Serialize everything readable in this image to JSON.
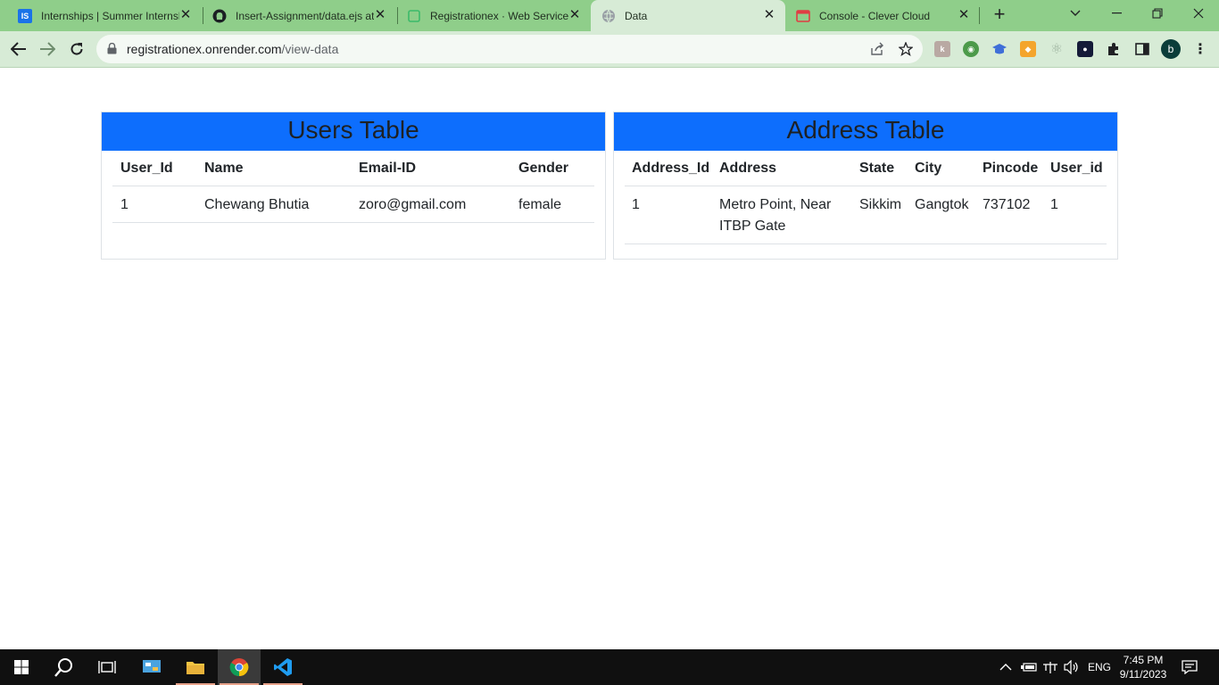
{
  "browser": {
    "tabs": [
      {
        "title": "Internships | Summer Internships",
        "favicon": "internshala-icon",
        "favicon_text": "IS",
        "favicon_color": "#1a73e8"
      },
      {
        "title": "Insert-Assignment/data.ejs at main",
        "favicon": "github-icon"
      },
      {
        "title": "Registrationex · Web Service",
        "favicon": "render-icon"
      },
      {
        "title": "Data",
        "favicon": "globe-icon",
        "active": true
      },
      {
        "title": "Console - Clever Cloud",
        "favicon": "clever-cloud-icon",
        "favicon_color": "#e03c43"
      }
    ],
    "address": {
      "host": "registrationex.onrender.com",
      "path": "/view-data"
    },
    "profile_initial": "b",
    "colors": {
      "tabstrip": "#8fce8a",
      "toolbar": "#d7ebd6"
    }
  },
  "users_table": {
    "title": "Users Table",
    "columns": [
      "User_Id",
      "Name",
      "Email-ID",
      "Gender"
    ],
    "rows": [
      [
        "1",
        "Chewang Bhutia",
        "zoro@gmail.com",
        "female"
      ]
    ]
  },
  "address_table": {
    "title": "Address Table",
    "columns": [
      "Address_Id",
      "Address",
      "State",
      "City",
      "Pincode",
      "User_id"
    ],
    "rows": [
      [
        "1",
        "Metro Point, Near",
        "ITBP Gate",
        "Sikkim",
        "Gangtok",
        "737102",
        "1"
      ]
    ]
  },
  "header_color": "#0d6efd",
  "taskbar": {
    "language": "ENG",
    "time": "7:45 PM",
    "date": "9/11/2023"
  }
}
